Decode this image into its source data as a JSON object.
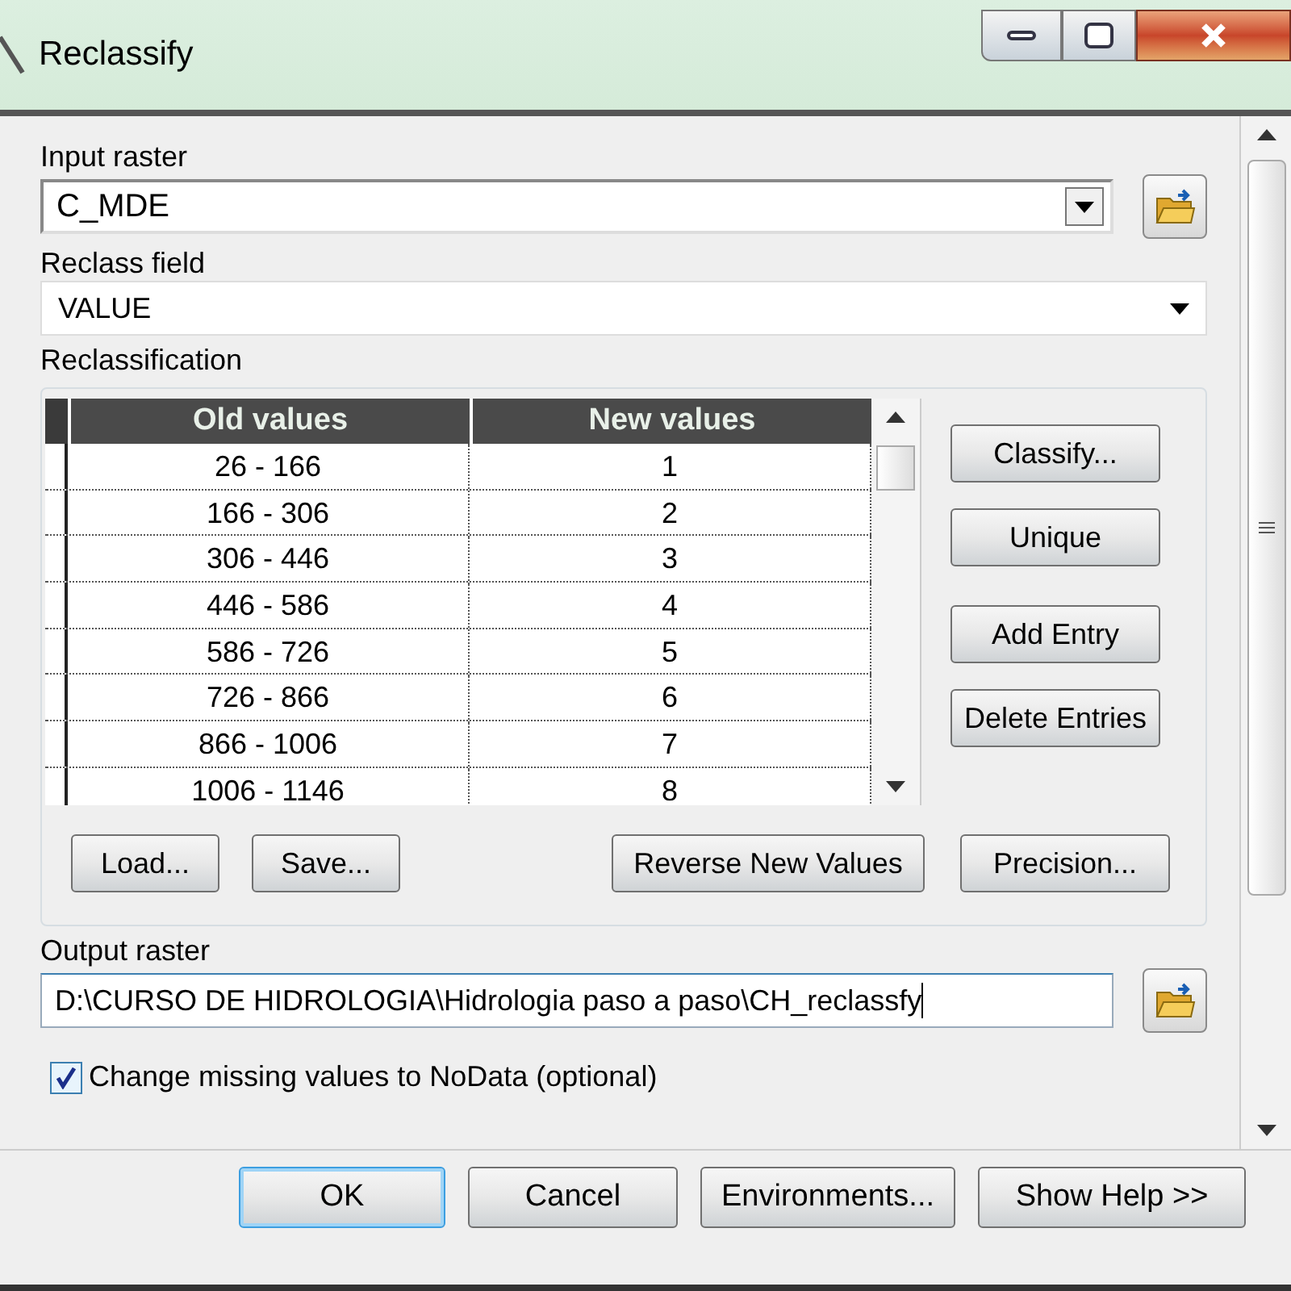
{
  "window": {
    "title": "Reclassify"
  },
  "input_raster": {
    "label": "Input raster",
    "value": "C_MDE"
  },
  "reclass_field": {
    "label": "Reclass field",
    "value": "VALUE"
  },
  "reclassification": {
    "label": "Reclassification",
    "table": {
      "columns": [
        "Old values",
        "New values"
      ],
      "rows": [
        [
          "26 - 166",
          "1"
        ],
        [
          "166 - 306",
          "2"
        ],
        [
          "306 - 446",
          "3"
        ],
        [
          "446 - 586",
          "4"
        ],
        [
          "586 - 726",
          "5"
        ],
        [
          "726 - 866",
          "6"
        ],
        [
          "866 - 1006",
          "7"
        ],
        [
          "1006 - 1146",
          "8"
        ]
      ]
    },
    "side_buttons": [
      "Classify...",
      "Unique",
      "Add Entry",
      "Delete Entries"
    ],
    "bottom_buttons_left": [
      "Load...",
      "Save..."
    ],
    "bottom_buttons_right": [
      "Reverse New Values",
      "Precision..."
    ]
  },
  "output_raster": {
    "label": "Output raster",
    "value": "D:\\CURSO DE HIDROLOGIA\\Hidrologia paso a paso\\CH_reclassfy"
  },
  "missing_values": {
    "label": "Change missing values to NoData (optional)",
    "checked": true
  },
  "buttons": [
    {
      "label": "OK",
      "default": true
    },
    {
      "label": "Cancel",
      "default": false
    },
    {
      "label": "Environments...",
      "default": false
    },
    {
      "label": "Show Help >>",
      "default": false
    }
  ]
}
